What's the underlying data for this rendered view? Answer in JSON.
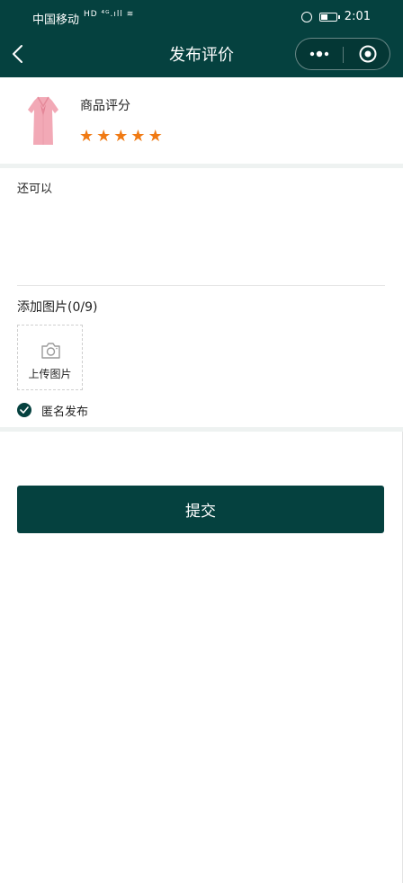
{
  "status_bar": {
    "carrier": "中国移动",
    "network_icons": "HD ⁴ᴳ.ıll ≋",
    "time": "2:01"
  },
  "nav": {
    "title": "发布评价",
    "back_icon": "chevron-left-icon",
    "more_icon": "more-dots-icon",
    "close_icon": "target-circle-icon"
  },
  "product": {
    "image_icon": "pink-dress-image",
    "rating_label": "商品评分",
    "rating": 5,
    "max_rating": 5,
    "star_color": "#f07a14"
  },
  "review": {
    "content": "还可以",
    "add_photo_label": "添加图片(0/9)",
    "upload_label": "上传图片",
    "anonymous_label": "匿名发布",
    "anonymous_checked": true
  },
  "actions": {
    "submit_label": "提交"
  },
  "theme": {
    "primary": "#05413f",
    "section_gap": "#eef2f1"
  }
}
